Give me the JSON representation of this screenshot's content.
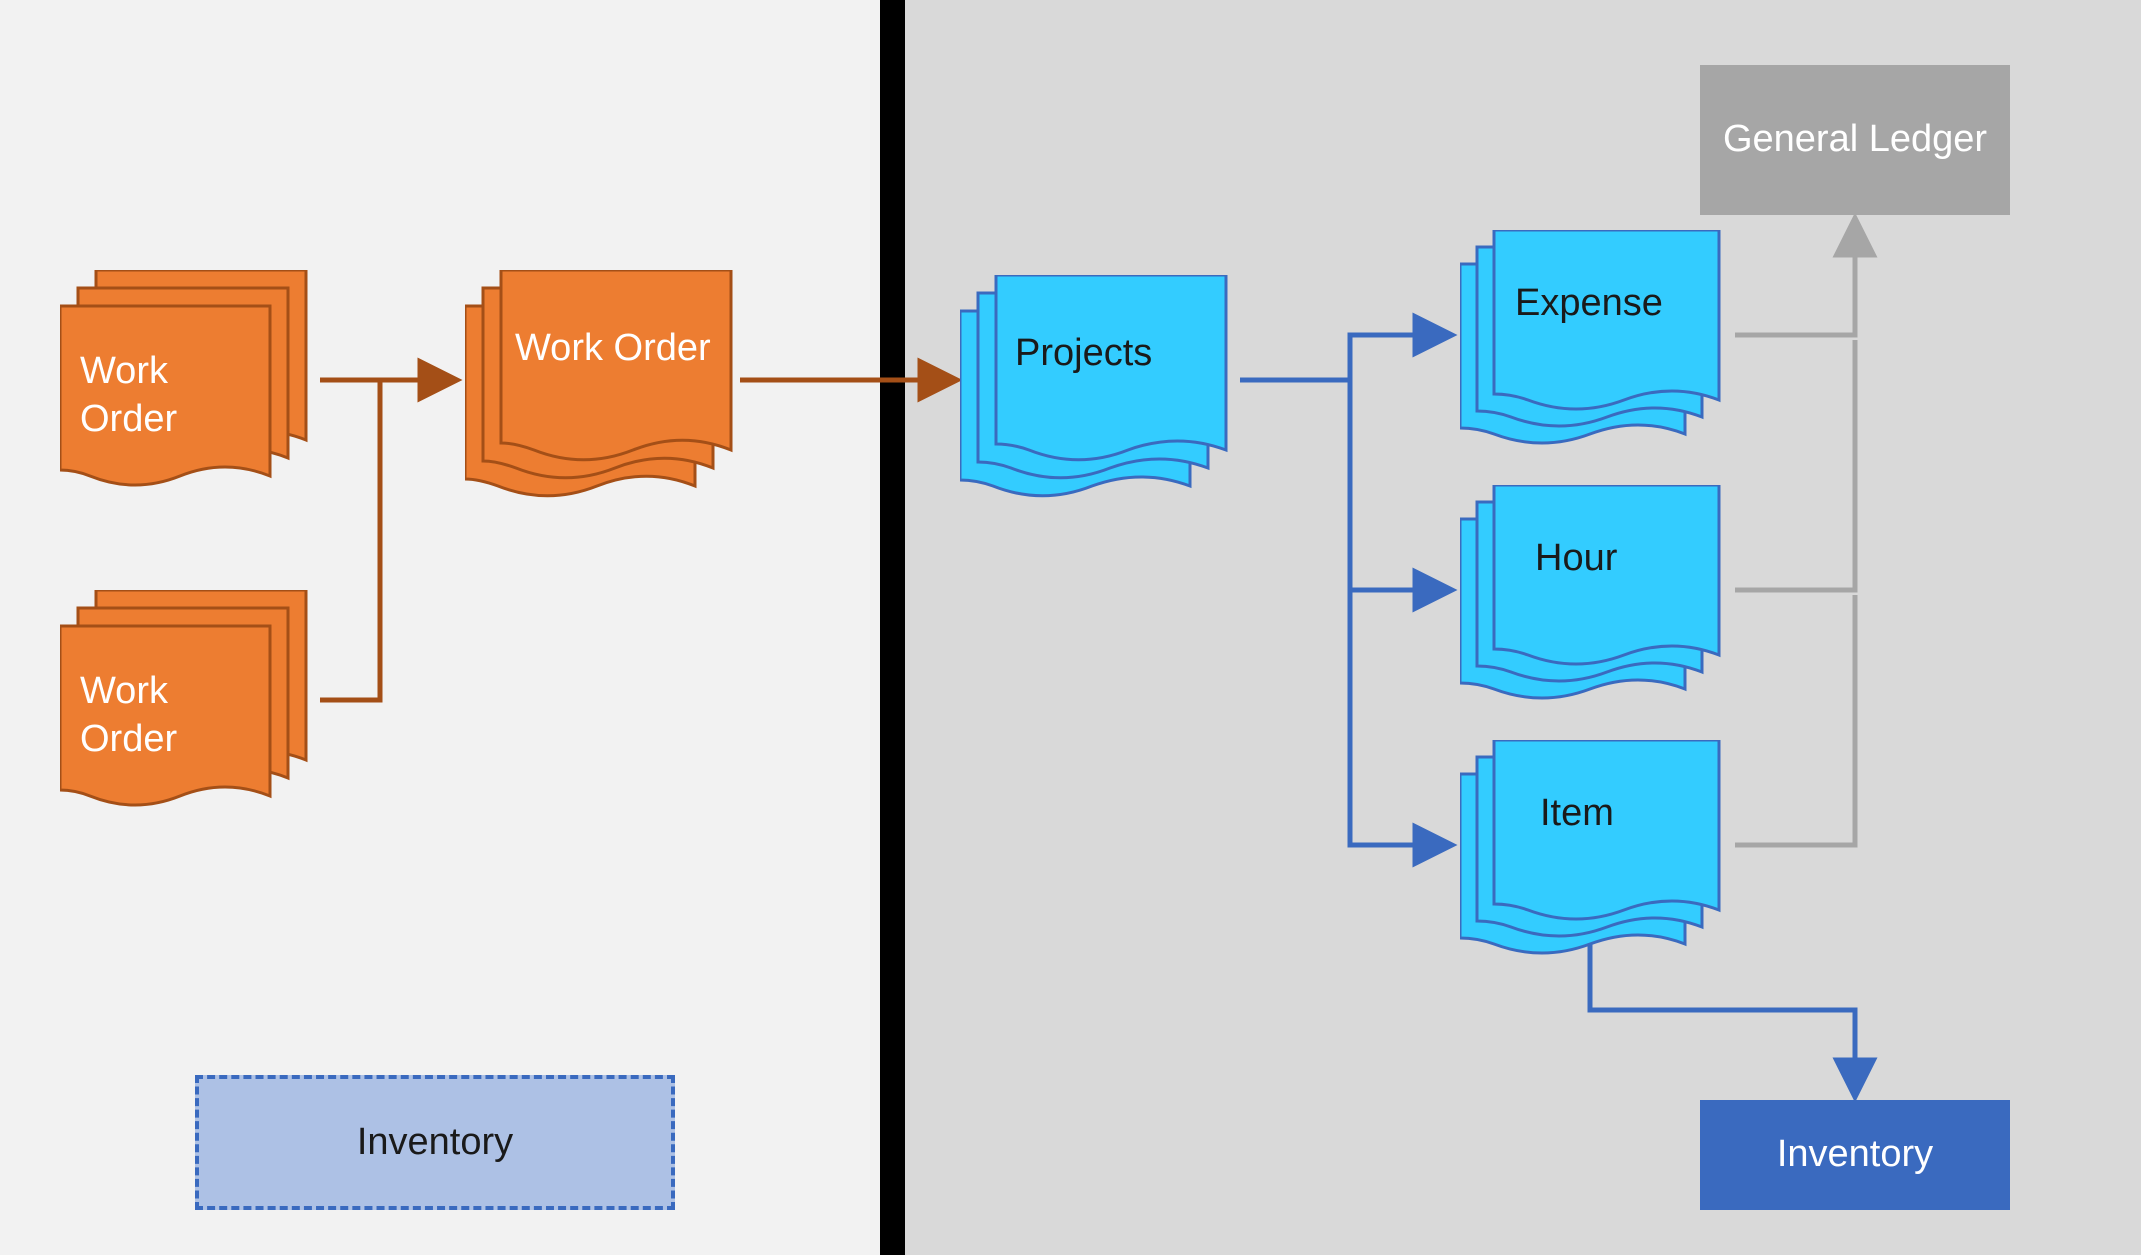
{
  "nodes": {
    "work_order_1": "Work Order",
    "work_order_2": "Work Order",
    "work_order_main": "Work Order",
    "projects": "Projects",
    "expense": "Expense",
    "hour": "Hour",
    "item": "Item",
    "general_ledger": "General Ledger",
    "inventory_left": "Inventory",
    "inventory_right": "Inventory"
  },
  "colors": {
    "orange_fill": "#ed7d31",
    "orange_stroke": "#a44f17",
    "cyan_fill": "#33ccff",
    "cyan_stroke": "#3a6abf",
    "grey_fill": "#a6a6a6",
    "grey_stroke": "#a6a6a6",
    "blue_fill": "#3a6abf",
    "light_blue_fill": "#adc1e5",
    "bg_left": "#f2f2f2",
    "bg_right": "#d9d9d9"
  },
  "arrows": [
    {
      "from": "work_order_1",
      "to": "work_order_main",
      "color": "orange"
    },
    {
      "from": "work_order_2",
      "to": "work_order_main",
      "color": "orange"
    },
    {
      "from": "work_order_main",
      "to": "projects",
      "color": "orange"
    },
    {
      "from": "projects",
      "to": "expense",
      "color": "blue"
    },
    {
      "from": "projects",
      "to": "hour",
      "color": "blue"
    },
    {
      "from": "projects",
      "to": "item",
      "color": "blue"
    },
    {
      "from": "expense",
      "to": "general_ledger",
      "color": "grey"
    },
    {
      "from": "hour",
      "to": "general_ledger",
      "color": "grey"
    },
    {
      "from": "item",
      "to": "general_ledger",
      "color": "grey"
    },
    {
      "from": "item",
      "to": "inventory_right",
      "color": "blue"
    }
  ]
}
